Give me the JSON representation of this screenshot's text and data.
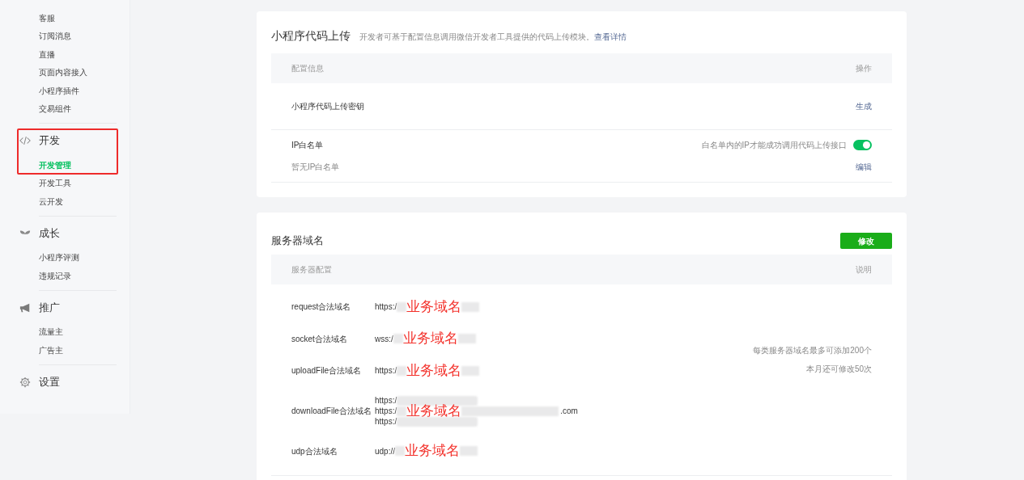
{
  "sidebar": {
    "groups": [
      {
        "highlighted": false,
        "items": [
          {
            "label": "客服",
            "selected": false
          },
          {
            "label": "订阅消息",
            "selected": false
          },
          {
            "label": "直播",
            "selected": false
          },
          {
            "label": "页面内容接入",
            "selected": false
          },
          {
            "label": "小程序插件",
            "selected": false
          },
          {
            "label": "交易组件",
            "selected": false
          }
        ]
      },
      {
        "heading": "开发",
        "highlighted": true,
        "items": [
          {
            "label": "开发管理",
            "selected": true
          },
          {
            "label": "开发工具",
            "selected": false
          },
          {
            "label": "云开发",
            "selected": false
          }
        ]
      },
      {
        "heading": "成长",
        "highlighted": false,
        "items": [
          {
            "label": "小程序评测",
            "selected": false
          },
          {
            "label": "违规记录",
            "selected": false
          }
        ]
      },
      {
        "heading": "推广",
        "highlighted": false,
        "items": [
          {
            "label": "流量主",
            "selected": false
          },
          {
            "label": "广告主",
            "selected": false
          }
        ]
      },
      {
        "heading": "设置",
        "highlighted": false
      }
    ]
  },
  "upload_card": {
    "title": "小程序代码上传",
    "description": "开发者可基于配置信息调用微信开发者工具提供的代码上传模块。",
    "link": "查看详情",
    "columns": [
      "配置信息",
      "操作"
    ],
    "rows": [
      {
        "label": "小程序代码上传密钥",
        "action": "生成"
      },
      {
        "label": "IP白名单",
        "sublabel": "暂无IP白名单",
        "toggle_hint": "白名单内的IP才能成功调用代码上传接口",
        "toggle_on": true,
        "action": "编辑"
      }
    ]
  },
  "server_card": {
    "title": "服务器域名",
    "button": "修改",
    "columns": [
      "服务器配置",
      "说明"
    ],
    "rows": [
      {
        "label": "request合法域名",
        "lines": [
          {
            "prefix": "https:/",
            "annotation": "业务域名"
          }
        ]
      },
      {
        "label": "socket合法域名",
        "lines": [
          {
            "prefix": "wss:/",
            "annotation": "业务域名"
          }
        ]
      },
      {
        "label": "uploadFile合法域名",
        "lines": [
          {
            "prefix": "https:/",
            "annotation": "业务域名"
          }
        ]
      },
      {
        "label": "downloadFile合法域名",
        "lines": [
          {
            "prefix": "https:/"
          },
          {
            "prefix": "https:/",
            "annotation": "业务域名",
            "suffix": ".com"
          },
          {
            "prefix": "https:/"
          }
        ]
      },
      {
        "label": "udp合法域名",
        "lines": [
          {
            "prefix": "udp://",
            "annotation": "业务域名"
          }
        ]
      }
    ],
    "notes": [
      "每类服务器域名最多可添加200个",
      "本月还可修改50次"
    ]
  }
}
